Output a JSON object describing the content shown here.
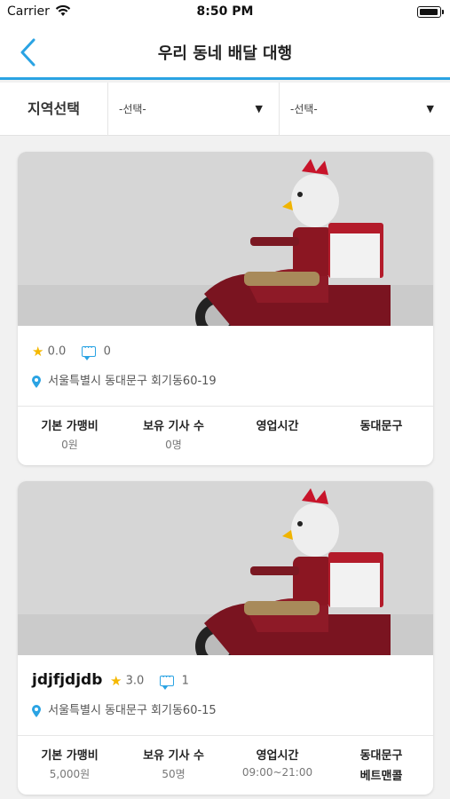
{
  "status_bar": {
    "carrier": "Carrier",
    "time": "8:50 PM"
  },
  "nav": {
    "title": "우리 동네 배달 대행"
  },
  "filter": {
    "label": "지역선택",
    "select1": "-선택-",
    "select2": "-선택-"
  },
  "cards": [
    {
      "name": "",
      "rating": "0.0",
      "comments": "0",
      "address": "서울특별시 동대문구 회기동60-19",
      "stats": [
        {
          "label": "기본 가맹비",
          "value": "0원"
        },
        {
          "label": "보유 기사 수",
          "value": "0명"
        },
        {
          "label": "영업시간",
          "value": ""
        },
        {
          "label": "동대문구",
          "value": ""
        }
      ]
    },
    {
      "name": "jdjfjdjdb",
      "rating": "3.0",
      "comments": "1",
      "address": "서울특별시 동대문구 회기동60-15",
      "stats": [
        {
          "label": "기본 가맹비",
          "value": "5,000원"
        },
        {
          "label": "보유 기사 수",
          "value": "50명"
        },
        {
          "label": "영업시간",
          "value": "09:00~21:00"
        },
        {
          "label": "동대문구",
          "value": "베트맨콜"
        }
      ]
    }
  ],
  "colors": {
    "accent": "#2aa3e3",
    "star": "#f5b800"
  },
  "icons": [
    "wifi-icon",
    "battery-icon",
    "back-arrow-icon",
    "caret-down-icon",
    "star-icon",
    "comment-icon",
    "location-pin-icon"
  ]
}
